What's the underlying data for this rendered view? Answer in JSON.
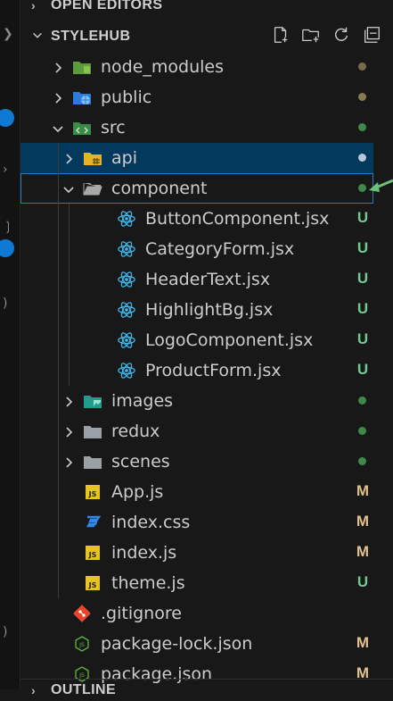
{
  "explorer": {
    "open_editors_label": "OPEN EDITORS",
    "project_label": "STYLEHUB",
    "outline_label": "OUTLINE",
    "toolbar": [
      "new-file-icon",
      "new-folder-icon",
      "refresh-icon",
      "collapse-all-icon"
    ]
  },
  "tree": [
    {
      "label": "node_modules",
      "icon": "node-modules-folder-icon",
      "status": "",
      "dot": "#7a6b4a"
    },
    {
      "label": "public",
      "icon": "public-folder-icon",
      "status": "",
      "dot": "#8a7a50"
    },
    {
      "label": "src",
      "icon": "src-folder-icon",
      "status": "",
      "dot": "#3f8a4a"
    },
    {
      "label": "api",
      "icon": "api-folder-icon",
      "status": "",
      "dot": "#b8c6d6"
    },
    {
      "label": "component",
      "icon": "folder-open-icon",
      "status": "",
      "dot": "#3f8a4a"
    },
    {
      "label": "ButtonComponent.jsx",
      "icon": "react-icon",
      "status": "U",
      "dot": ""
    },
    {
      "label": "CategoryForm.jsx",
      "icon": "react-icon",
      "status": "U",
      "dot": ""
    },
    {
      "label": "HeaderText.jsx",
      "icon": "react-icon",
      "status": "U",
      "dot": ""
    },
    {
      "label": "HighlightBg.jsx",
      "icon": "react-icon",
      "status": "U",
      "dot": ""
    },
    {
      "label": "LogoComponent.jsx",
      "icon": "react-icon",
      "status": "U",
      "dot": ""
    },
    {
      "label": "ProductForm.jsx",
      "icon": "react-icon",
      "status": "U",
      "dot": ""
    },
    {
      "label": "images",
      "icon": "images-folder-icon",
      "status": "",
      "dot": "#3f8a4a"
    },
    {
      "label": "redux",
      "icon": "folder-icon",
      "status": "",
      "dot": "#3f8a4a"
    },
    {
      "label": "scenes",
      "icon": "folder-icon",
      "status": "",
      "dot": "#3f8a4a"
    },
    {
      "label": "App.js",
      "icon": "js-icon",
      "status": "M",
      "dot": ""
    },
    {
      "label": "index.css",
      "icon": "css-icon",
      "status": "M",
      "dot": ""
    },
    {
      "label": "index.js",
      "icon": "js-icon",
      "status": "M",
      "dot": ""
    },
    {
      "label": "theme.js",
      "icon": "js-icon",
      "status": "U",
      "dot": ""
    },
    {
      "label": ".gitignore",
      "icon": "git-icon",
      "status": "",
      "dot": ""
    },
    {
      "label": "package-lock.json",
      "icon": "json-icon",
      "status": "M",
      "dot": ""
    },
    {
      "label": "package.json",
      "icon": "json-icon",
      "status": "M",
      "dot": ""
    }
  ],
  "colors": {
    "untracked": "#73c991",
    "modified": "#e2c08d",
    "selection": "#04395e",
    "focus_border": "#2b79c2",
    "annotation_arrow": "#6cc07a"
  }
}
